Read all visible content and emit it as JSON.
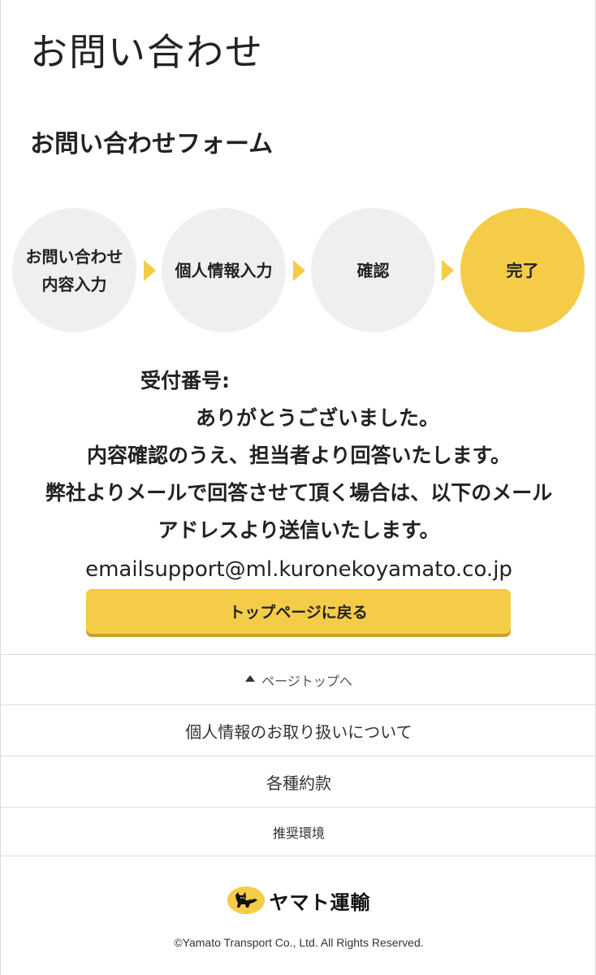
{
  "page": {
    "title": "お問い合わせ",
    "section_title": "お問い合わせフォーム"
  },
  "steps": [
    {
      "label": "お問い合わせ\n内容入力",
      "active": false
    },
    {
      "label": "個人情報入力",
      "active": false
    },
    {
      "label": "確認",
      "active": false
    },
    {
      "label": "完了",
      "active": true
    }
  ],
  "message": {
    "receipt_label": "受付番号:",
    "thanks": "ありがとうございました。",
    "line1": "内容確認のうえ、担当者より回答いたします。",
    "line2": "弊社よりメールで回答させて頂く場合は、以下のメール",
    "line3": "アドレスより送信いたします。",
    "email": "emailsupport@ml.kuronekoyamato.co.jp"
  },
  "buttons": {
    "top_page": "トップページに戻る"
  },
  "footer": {
    "page_top": "ページトップへ",
    "privacy": "個人情報のお取り扱いについて",
    "terms": "各種約款",
    "environment": "推奨環境",
    "brand_name": "ヤマト運輸",
    "copyright": "©Yamato Transport Co., Ltd. All Rights Reserved."
  },
  "colors": {
    "accent": "#f4cc47",
    "inactive_step": "#efefef",
    "text": "#222222"
  },
  "icons": {
    "page_top": "caret-up-icon",
    "logo": "black-cat-logo-icon"
  }
}
